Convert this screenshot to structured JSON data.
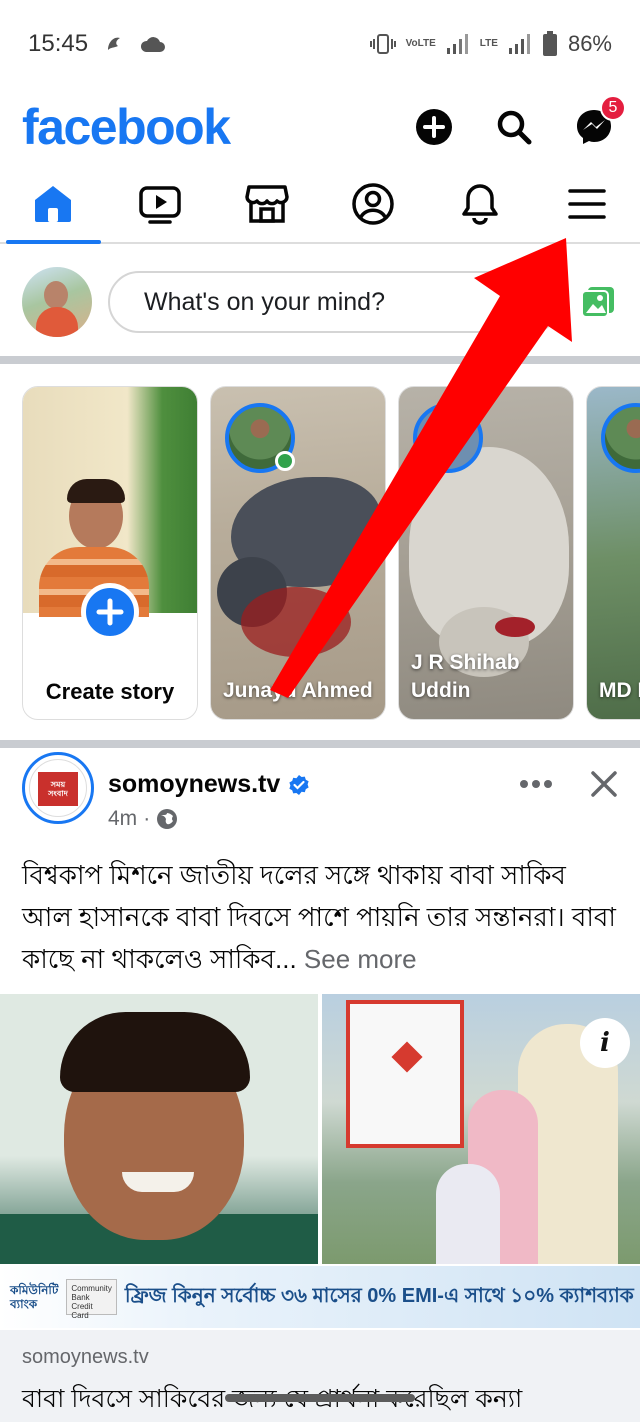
{
  "status_bar": {
    "time": "15:45",
    "battery": "86%",
    "volte": "VoLTE",
    "lte": "LTE"
  },
  "header": {
    "logo": "facebook",
    "messenger_badge": "5"
  },
  "composer": {
    "placeholder": "What's on your mind?"
  },
  "stories": [
    {
      "type": "create",
      "label": "Create story"
    },
    {
      "type": "story",
      "name": "Junayd Ahmed"
    },
    {
      "type": "story",
      "name": "J R Shihab Uddin"
    },
    {
      "type": "story",
      "name": "MD Rosh"
    }
  ],
  "post": {
    "author": "somoynews.tv",
    "time": "4m",
    "text": "বিশ্বকাপ মিশনে জাতীয় দলের সঙ্গে থাকায় বাবা সাকিব আল হাসানকে বাবা দিবসে পাশে পায়নি তার সন্তানরা। বাবা কাছে না থাকলেও সাকিব...",
    "see_more": "See more",
    "ad": {
      "bank": "কমিউনিটি ব্যাংক",
      "card": "Community Bank Credit Card",
      "offer": "ফ্রিজ কিনুন সর্বোচ্চ ৩৬ মাসের 0% EMI-এ সাথে ১০% ক্যাশব্যাক"
    },
    "link": {
      "domain": "somoynews.tv",
      "title": "বাবা দিবসে সাকিবের জন্য যে প্রার্থনা করেছিল কন্যা"
    }
  },
  "colors": {
    "brand": "#1877f2",
    "badge": "#e41e3f",
    "annotation_arrow": "#ff0000"
  }
}
